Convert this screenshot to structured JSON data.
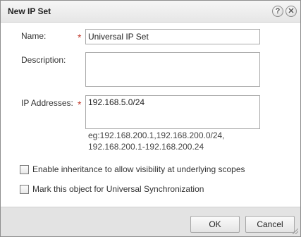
{
  "dialog": {
    "title": "New IP Set",
    "help_icon": "question-icon",
    "close_icon": "close-icon"
  },
  "form": {
    "name_label": "Name:",
    "name_value": "Universal IP Set",
    "description_label": "Description:",
    "description_value": "",
    "ip_label": "IP Addresses:",
    "ip_value": "192.168.5.0/24",
    "ip_hint_line1": "eg:192.168.200.1,192.168.200.0/24,",
    "ip_hint_line2": "192.168.200.1-192.168.200.24",
    "required_mark": "*"
  },
  "options": {
    "inheritance_label": "Enable inheritance to allow visibility at underlying scopes",
    "inheritance_checked": false,
    "universal_label": "Mark this object for Universal Synchronization",
    "universal_checked": false
  },
  "footer": {
    "ok_label": "OK",
    "cancel_label": "Cancel"
  },
  "colors": {
    "required": "#c0392b",
    "footer_bg": "#e3e3e3"
  }
}
